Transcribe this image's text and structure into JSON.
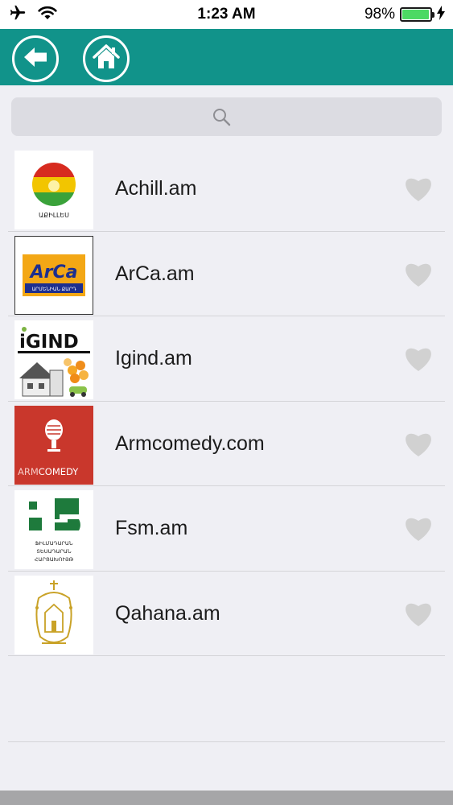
{
  "status_bar": {
    "time": "1:23 AM",
    "battery_percent": "98%",
    "battery_level": 0.98,
    "icons": [
      "airplane-icon",
      "wifi-icon",
      "battery-icon",
      "charging-bolt-icon"
    ]
  },
  "nav": {
    "back_icon": "arrow-left-icon",
    "home_icon": "home-icon",
    "color": "#11938a"
  },
  "search": {
    "placeholder": "",
    "icon": "search-icon"
  },
  "sites": [
    {
      "name": "Achill.am",
      "logo_icon": "achill-logo-icon",
      "logo_caption": "ԱՔԻԼԼԵՍ"
    },
    {
      "name": "ArCa.am",
      "logo_icon": "arca-logo-icon",
      "logo_text": "ArCa",
      "logo_caption": "ԱՐՄԵՆԻԱՆ ՔԱՐԴ"
    },
    {
      "name": "Igind.am",
      "logo_icon": "igind-logo-icon",
      "logo_text": "iGIND"
    },
    {
      "name": "Armcomedy.com",
      "logo_icon": "armcomedy-logo-icon",
      "logo_text_a": "ARM",
      "logo_text_b": "COMEDY"
    },
    {
      "name": "Fsm.am",
      "logo_icon": "fsm-logo-icon",
      "logo_caption_lines": [
        "ՖԻԼՄԱԴԱՐԱՆ",
        "ՏԵՍԱԴԱՐԱՆ",
        "ՀԱՐՑԱԽՈՒՅԹ"
      ]
    },
    {
      "name": "Qahana.am",
      "logo_icon": "qahana-logo-icon"
    }
  ],
  "colors": {
    "accent": "#11938a",
    "heart_inactive": "#d1d1d1",
    "battery": "#4cd964"
  }
}
